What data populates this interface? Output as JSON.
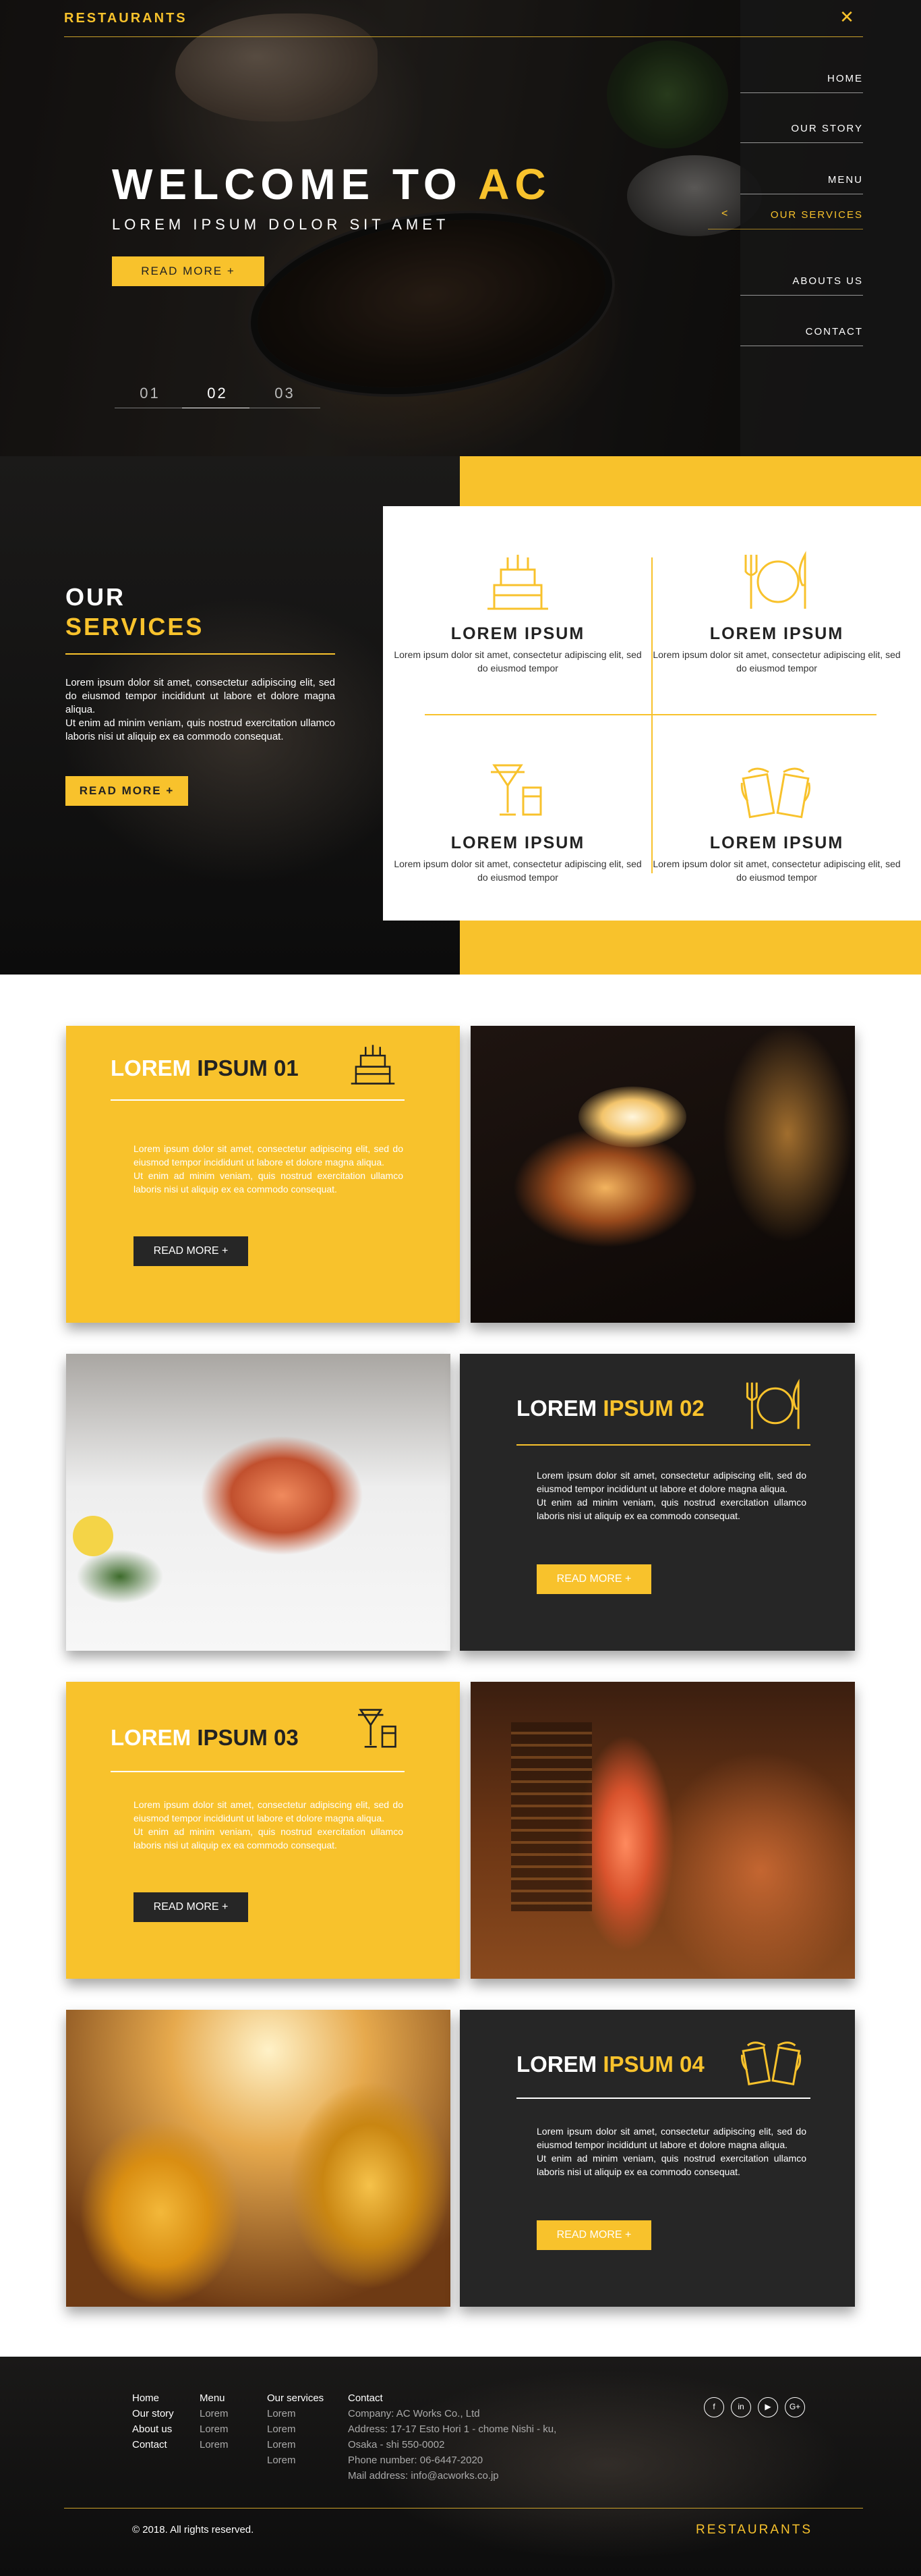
{
  "brand": "RESTAURANTS",
  "nav": [
    {
      "label": "HOME"
    },
    {
      "label": "OUR STORY"
    },
    {
      "label": "MENU"
    },
    {
      "label": "OUR SERVICES",
      "active": true
    },
    {
      "label": "ABOUTS US"
    },
    {
      "label": "CONTACT"
    }
  ],
  "hero": {
    "title_main": "WELCOME TO ",
    "title_highlight": "AC",
    "subtitle": "LOREM IPSUM DOLOR SIT AMET",
    "button": "READ MORE  +",
    "slides": [
      "01",
      "02",
      "03"
    ],
    "active_slide": "02"
  },
  "services": {
    "heading_line1": "OUR",
    "heading_line2": "SERVICES",
    "text": "Lorem ipsum dolor sit amet, consectetur adipiscing elit, sed do eiusmod tempor incididunt ut labore et dolore magna aliqua.\nUt enim ad minim veniam, quis nostrud exercitation ullamco laboris nisi ut aliquip ex ea commodo consequat.",
    "button": "READ MORE +",
    "items": [
      {
        "title": "LOREM IPSUM",
        "text": "Lorem ipsum dolor sit amet, consectetur adipiscing elit, sed do eiusmod tempor",
        "icon": "cake-icon"
      },
      {
        "title": "LOREM IPSUM",
        "text": "Lorem ipsum dolor sit amet, consectetur adipiscing elit, sed do eiusmod tempor",
        "icon": "fork-plate-knife-icon"
      },
      {
        "title": "LOREM IPSUM",
        "text": "Lorem ipsum dolor sit amet, consectetur adipiscing elit, sed do eiusmod tempor",
        "icon": "cocktail-icon"
      },
      {
        "title": "LOREM IPSUM",
        "text": "Lorem ipsum dolor sit amet, consectetur adipiscing elit, sed do eiusmod tempor",
        "icon": "beer-mugs-icon"
      }
    ]
  },
  "features": [
    {
      "title_a": "LOREM ",
      "title_b": "IPSUM 01",
      "text": "Lorem ipsum dolor sit amet, consectetur adipiscing elit, sed do eiusmod tempor incididunt ut labore et dolore magna aliqua.\nUt enim ad minim veniam, quis nostrud exercitation ullamco laboris nisi ut aliquip ex ea commodo consequat.",
      "button": "READ MORE   +",
      "icon": "cake-icon",
      "photo": "birthday-cake-photo"
    },
    {
      "title_a": "LOREM ",
      "title_b": "IPSUM 02",
      "text": "Lorem ipsum dolor sit amet, consectetur adipiscing elit, sed do eiusmod tempor incididunt ut labore et dolore magna aliqua.\nUt enim ad minim veniam, quis nostrud exercitation ullamco laboris nisi ut aliquip ex ea commodo consequat.",
      "button": "READ MORE   +",
      "icon": "fork-plate-knife-icon",
      "photo": "salmon-photo"
    },
    {
      "title_a": "LOREM ",
      "title_b": "IPSUM 03",
      "text": "Lorem ipsum dolor sit amet, consectetur adipiscing elit, sed do eiusmod tempor incididunt ut labore et dolore magna aliqua.\nUt enim ad minim veniam, quis nostrud exercitation ullamco laboris nisi ut aliquip ex ea commodo consequat.",
      "button": "READ MORE   +",
      "icon": "cocktail-icon",
      "photo": "cocktail-bar-photo"
    },
    {
      "title_a": "LOREM ",
      "title_b": "IPSUM 04",
      "text": "Lorem ipsum dolor sit amet, consectetur adipiscing elit, sed do eiusmod tempor incididunt ut labore et dolore magna aliqua.\nUt enim ad minim veniam, quis nostrud exercitation ullamco laboris nisi ut aliquip ex ea commodo consequat.",
      "button": "READ MORE   +",
      "icon": "beer-mugs-icon",
      "photo": "beer-toast-photo"
    }
  ],
  "footer": {
    "col_home": [
      "Home",
      "Our story",
      "About us",
      "Contact"
    ],
    "col_menu": [
      "Menu",
      "Lorem",
      "Lorem",
      "Lorem"
    ],
    "col_services": [
      "Our services",
      "Lorem",
      "Lorem",
      "Lorem",
      "Lorem"
    ],
    "col_contact": [
      "Contact",
      "Company: AC Works Co., Ltd",
      "Address: 17-17 Esto Hori 1 - chome Nishi - ku,",
      "Osaka - shi 550-0002",
      "Phone number: 06-6447-2020",
      "Mail address: info@acworks.co.jp"
    ],
    "social": [
      "f",
      "in",
      "▶",
      "G+"
    ],
    "copyright": "© 2018. All rights reserved.",
    "brand": "RESTAURANTS"
  },
  "colors": {
    "accent": "#f8c22c",
    "dark": "#262626",
    "footer_bg": "#121212"
  }
}
